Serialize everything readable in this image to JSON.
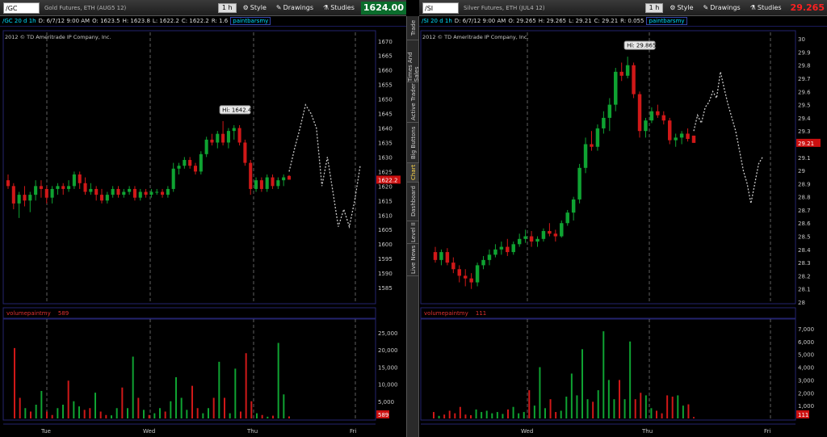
{
  "left": {
    "symbol": "/GC",
    "description": "Gold Futures, ETH (AUG5 12)",
    "aggregation": "1 h",
    "style_label": "Style",
    "drawings_label": "Drawings",
    "studies_label": "Studies",
    "last_price": "1624.00",
    "chart_header": "/GC 20 d 1h",
    "ohlc": {
      "date": "D: 6/7/12 9:00 AM",
      "open": "O: 1623.5",
      "high": "H: 1623.8",
      "low": "L: 1622.2",
      "close": "C: 1622.2",
      "range": "R: 1.6"
    },
    "study": "paintbarsmy",
    "copyright": "2012 © TD Ameritrade IP Company, Inc.",
    "hi_label": "Hi: 1642.4",
    "price_marker": "1622.2",
    "volume_study": "volumepaintmy",
    "volume_value": "589",
    "volume_marker": "589",
    "price_ticks": [
      "1670",
      "1665",
      "1660",
      "1655",
      "1650",
      "1645",
      "1640",
      "1635",
      "1630",
      "1625",
      "1620",
      "1615",
      "1610",
      "1605",
      "1600",
      "1595",
      "1590",
      "1585"
    ],
    "volume_ticks": [
      "25,000",
      "20,000",
      "15,000",
      "10,000",
      "5,000"
    ],
    "date_labels": [
      "Tue",
      "Wed",
      "Thu",
      "Fri"
    ]
  },
  "right": {
    "symbol": "/SI",
    "description": "Silver Futures, ETH (JUL4 12)",
    "aggregation": "1 h",
    "style_label": "Style",
    "drawings_label": "Drawings",
    "studies_label": "Studies",
    "last_price": "29.265",
    "chart_header": "/SI 20 d 1h",
    "ohlc": {
      "date": "D: 6/7/12 9:00 AM",
      "open": "O: 29.265",
      "high": "H: 29.265",
      "low": "L: 29.21",
      "close": "C: 29.21",
      "range": "R: 0.055"
    },
    "study": "paintbarsmy",
    "copyright": "2012 © TD Ameritrade IP Company, Inc.",
    "hi_label": "Hi: 29.865",
    "price_marker": "29.21",
    "volume_study": "volumepaintmy",
    "volume_value": "111",
    "volume_marker": "111",
    "price_ticks": [
      "30",
      "29.9",
      "29.8",
      "29.7",
      "29.6",
      "29.5",
      "29.4",
      "29.3",
      "29.2",
      "29.1",
      "29",
      "28.9",
      "28.8",
      "28.7",
      "28.6",
      "28.5",
      "28.4",
      "28.3",
      "28.2",
      "28.1",
      "28"
    ],
    "volume_ticks": [
      "7,000",
      "6,000",
      "5,000",
      "4,000",
      "3,000",
      "2,000",
      "1,000"
    ],
    "date_labels": [
      "Wed",
      "Thu",
      "Fri"
    ]
  },
  "side_tabs": [
    "Trade",
    "Times And Sales",
    "Active Trader",
    "Big Buttons",
    "Chart",
    "Dashboard",
    "Level II",
    "Live News"
  ],
  "active_tab": "Chart",
  "chart_data": [
    {
      "type": "candlestick",
      "title": "/GC 20 d 1h",
      "ylim": [
        1580,
        1673
      ],
      "colors": {
        "up": "#0fa332",
        "down": "#d01818",
        "projection": "#c8c8c8"
      },
      "candles": [
        [
          1622,
          1624,
          1619,
          1620
        ],
        [
          1620,
          1621,
          1612,
          1614
        ],
        [
          1614,
          1618,
          1609,
          1617
        ],
        [
          1617,
          1620,
          1613,
          1615
        ],
        [
          1615,
          1618,
          1611,
          1617
        ],
        [
          1617,
          1622,
          1615,
          1620
        ],
        [
          1620,
          1622,
          1616,
          1619
        ],
        [
          1619,
          1620,
          1614,
          1616
        ],
        [
          1616,
          1620,
          1614,
          1619
        ],
        [
          1619,
          1621,
          1617,
          1620
        ],
        [
          1620,
          1621,
          1617,
          1619
        ],
        [
          1619,
          1622,
          1618,
          1620
        ],
        [
          1620,
          1625,
          1619,
          1624
        ],
        [
          1624,
          1625,
          1619,
          1621
        ],
        [
          1621,
          1623,
          1617,
          1618
        ],
        [
          1618,
          1621,
          1617,
          1619
        ],
        [
          1619,
          1620,
          1615,
          1617
        ],
        [
          1617,
          1619,
          1614,
          1615
        ],
        [
          1615,
          1618,
          1614,
          1617
        ],
        [
          1617,
          1620,
          1616,
          1619
        ],
        [
          1619,
          1620,
          1616,
          1617
        ],
        [
          1617,
          1619,
          1616,
          1618
        ],
        [
          1618,
          1620,
          1617,
          1619
        ],
        [
          1619,
          1620,
          1615,
          1616
        ],
        [
          1616,
          1619,
          1615,
          1618
        ],
        [
          1618,
          1619,
          1616,
          1617
        ],
        [
          1617,
          1619,
          1616,
          1618
        ],
        [
          1618,
          1619,
          1617,
          1618
        ],
        [
          1618,
          1619,
          1616,
          1617
        ],
        [
          1617,
          1620,
          1616,
          1619
        ],
        [
          1619,
          1628,
          1618,
          1626
        ],
        [
          1626,
          1628,
          1624,
          1627
        ],
        [
          1627,
          1630,
          1626,
          1629
        ],
        [
          1629,
          1630,
          1626,
          1627
        ],
        [
          1627,
          1628,
          1624,
          1625
        ],
        [
          1625,
          1632,
          1624,
          1631
        ],
        [
          1631,
          1637,
          1630,
          1636
        ],
        [
          1636,
          1638,
          1634,
          1635
        ],
        [
          1635,
          1639,
          1633,
          1638
        ],
        [
          1638,
          1642.4,
          1634,
          1635
        ],
        [
          1635,
          1640,
          1633,
          1639
        ],
        [
          1639,
          1641,
          1636,
          1640
        ],
        [
          1640,
          1641,
          1634,
          1635
        ],
        [
          1635,
          1636,
          1627,
          1628
        ],
        [
          1628,
          1629,
          1617,
          1619
        ],
        [
          1619,
          1623,
          1618,
          1622
        ],
        [
          1622,
          1623,
          1618,
          1619
        ],
        [
          1619,
          1624,
          1618,
          1623
        ],
        [
          1623,
          1624,
          1619,
          1620
        ],
        [
          1620,
          1623,
          1619,
          1622
        ],
        [
          1622,
          1624,
          1620,
          1623
        ],
        [
          1623.5,
          1623.8,
          1622.2,
          1622.2
        ]
      ],
      "projection": [
        1625,
        1633,
        1640,
        1648,
        1645,
        1640,
        1620,
        1630,
        1618,
        1606,
        1612,
        1606,
        1615,
        1627
      ],
      "volume": [
        20500,
        6000,
        3000,
        2000,
        4000,
        8000,
        2000,
        1000,
        3000,
        4000,
        11000,
        5000,
        3500,
        2500,
        3000,
        7500,
        2000,
        1000,
        900,
        3000,
        9000,
        3000,
        18000,
        6000,
        2500,
        1000,
        1500,
        3000,
        2000,
        5000,
        12000,
        6000,
        2500,
        9500,
        3000,
        1500,
        3000,
        6000,
        16500,
        6000,
        1500,
        14500,
        2000,
        19000,
        5000,
        1500,
        1000,
        500,
        800,
        22000,
        7000,
        589
      ],
      "volume_ylim": [
        0,
        28000
      ]
    },
    {
      "type": "candlestick",
      "title": "/SI 20 d 1h",
      "ylim": [
        28.0,
        30.05
      ],
      "colors": {
        "up": "#0fa332",
        "down": "#d01818",
        "projection": "#c8c8c8"
      },
      "candles": [
        [
          28.38,
          28.42,
          28.3,
          28.32
        ],
        [
          28.32,
          28.4,
          28.28,
          28.38
        ],
        [
          28.38,
          28.41,
          28.28,
          28.3
        ],
        [
          28.3,
          28.34,
          28.22,
          28.25
        ],
        [
          28.25,
          28.28,
          28.15,
          28.2
        ],
        [
          28.2,
          28.25,
          28.12,
          28.18
        ],
        [
          28.18,
          28.22,
          28.1,
          28.15
        ],
        [
          28.15,
          28.3,
          28.12,
          28.28
        ],
        [
          28.28,
          28.35,
          28.25,
          28.32
        ],
        [
          28.32,
          28.4,
          28.28,
          28.36
        ],
        [
          28.36,
          28.44,
          28.34,
          28.4
        ],
        [
          28.4,
          28.46,
          28.36,
          28.42
        ],
        [
          28.42,
          28.48,
          28.35,
          28.38
        ],
        [
          28.38,
          28.46,
          28.36,
          28.44
        ],
        [
          28.44,
          28.52,
          28.42,
          28.48
        ],
        [
          28.48,
          28.55,
          28.45,
          28.5
        ],
        [
          28.5,
          28.54,
          28.42,
          28.46
        ],
        [
          28.46,
          28.5,
          28.42,
          28.48
        ],
        [
          28.48,
          28.56,
          28.46,
          28.54
        ],
        [
          28.54,
          28.6,
          28.5,
          28.52
        ],
        [
          28.52,
          28.55,
          28.46,
          28.5
        ],
        [
          28.5,
          28.62,
          28.49,
          28.6
        ],
        [
          28.6,
          28.7,
          28.58,
          28.68
        ],
        [
          28.68,
          28.8,
          28.62,
          28.78
        ],
        [
          28.78,
          29.05,
          28.75,
          29.02
        ],
        [
          29.02,
          29.25,
          28.98,
          29.2
        ],
        [
          29.2,
          29.3,
          29.15,
          29.18
        ],
        [
          29.18,
          29.35,
          29.15,
          29.32
        ],
        [
          29.32,
          29.45,
          29.28,
          29.4
        ],
        [
          29.4,
          29.55,
          29.3,
          29.5
        ],
        [
          29.5,
          29.78,
          29.45,
          29.75
        ],
        [
          29.75,
          29.82,
          29.68,
          29.72
        ],
        [
          29.72,
          29.865,
          29.7,
          29.8
        ],
        [
          29.8,
          29.82,
          29.55,
          29.58
        ],
        [
          29.58,
          29.6,
          29.25,
          29.3
        ],
        [
          29.3,
          29.4,
          29.25,
          29.38
        ],
        [
          29.38,
          29.48,
          29.36,
          29.45
        ],
        [
          29.45,
          29.5,
          29.4,
          29.42
        ],
        [
          29.42,
          29.45,
          29.35,
          29.38
        ],
        [
          29.38,
          29.4,
          29.2,
          29.23
        ],
        [
          29.23,
          29.28,
          29.18,
          29.25
        ],
        [
          29.25,
          29.3,
          29.2,
          29.28
        ],
        [
          29.28,
          29.32,
          29.22,
          29.24
        ],
        [
          29.265,
          29.265,
          29.21,
          29.21
        ]
      ],
      "projection": [
        29.3,
        29.42,
        29.36,
        29.48,
        29.52,
        29.6,
        29.55,
        29.75,
        29.62,
        29.5,
        29.4,
        29.3,
        29.15,
        29.0,
        28.9,
        28.75,
        28.9,
        29.05,
        29.1
      ],
      "volume": [
        500,
        200,
        300,
        600,
        400,
        900,
        300,
        250,
        700,
        500,
        600,
        400,
        500,
        350,
        700,
        900,
        400,
        500,
        2200,
        1000,
        4000,
        800,
        1500,
        500,
        600,
        1700,
        3500,
        1800,
        5400,
        1500,
        1300,
        2200,
        6800,
        3000,
        1500,
        3000,
        1500,
        6000,
        1500,
        2000,
        1800,
        800,
        600,
        400,
        1800,
        1700,
        1800,
        1000,
        1100,
        111
      ],
      "volume_ylim": [
        0,
        7500
      ]
    }
  ]
}
